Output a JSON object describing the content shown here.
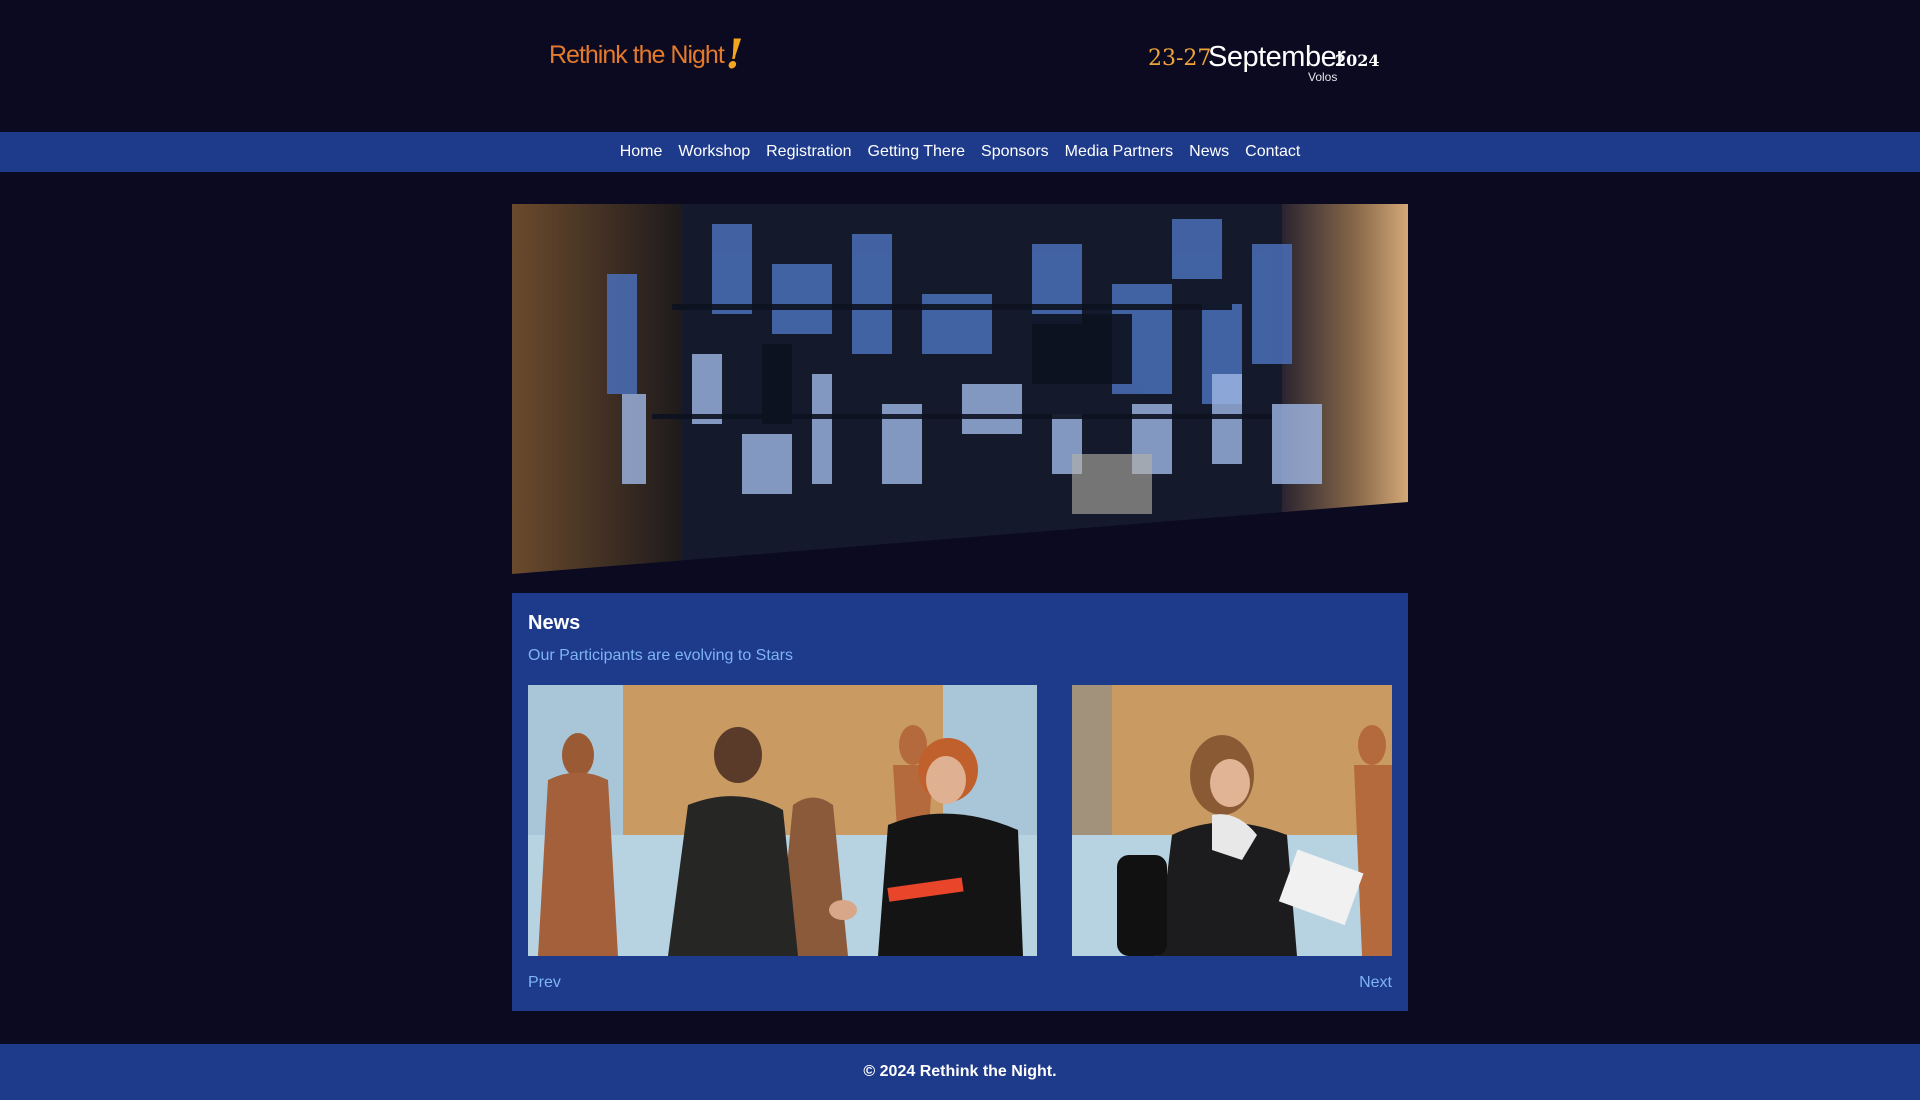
{
  "header": {
    "logo_text": "Rethink the Night",
    "logo_mark": "!",
    "date_range": "23-27",
    "month": "September",
    "year": "2024",
    "city": "Volos"
  },
  "nav": {
    "items": [
      {
        "label": "Home"
      },
      {
        "label": "Workshop"
      },
      {
        "label": "Registration"
      },
      {
        "label": "Getting There"
      },
      {
        "label": "Sponsors"
      },
      {
        "label": "Media Partners"
      },
      {
        "label": "News"
      },
      {
        "label": "Contact"
      }
    ]
  },
  "news": {
    "heading": "News",
    "article_title": "Our Participants are evolving to Stars",
    "prev_label": "Prev",
    "next_label": "Next"
  },
  "footer": {
    "copyright": "© 2024 Rethink the Night."
  },
  "colors": {
    "background": "#0b0a21",
    "nav_blue": "#1e3a8a",
    "accent_orange": "#e47a2c",
    "link_blue": "#7eb4f5"
  }
}
